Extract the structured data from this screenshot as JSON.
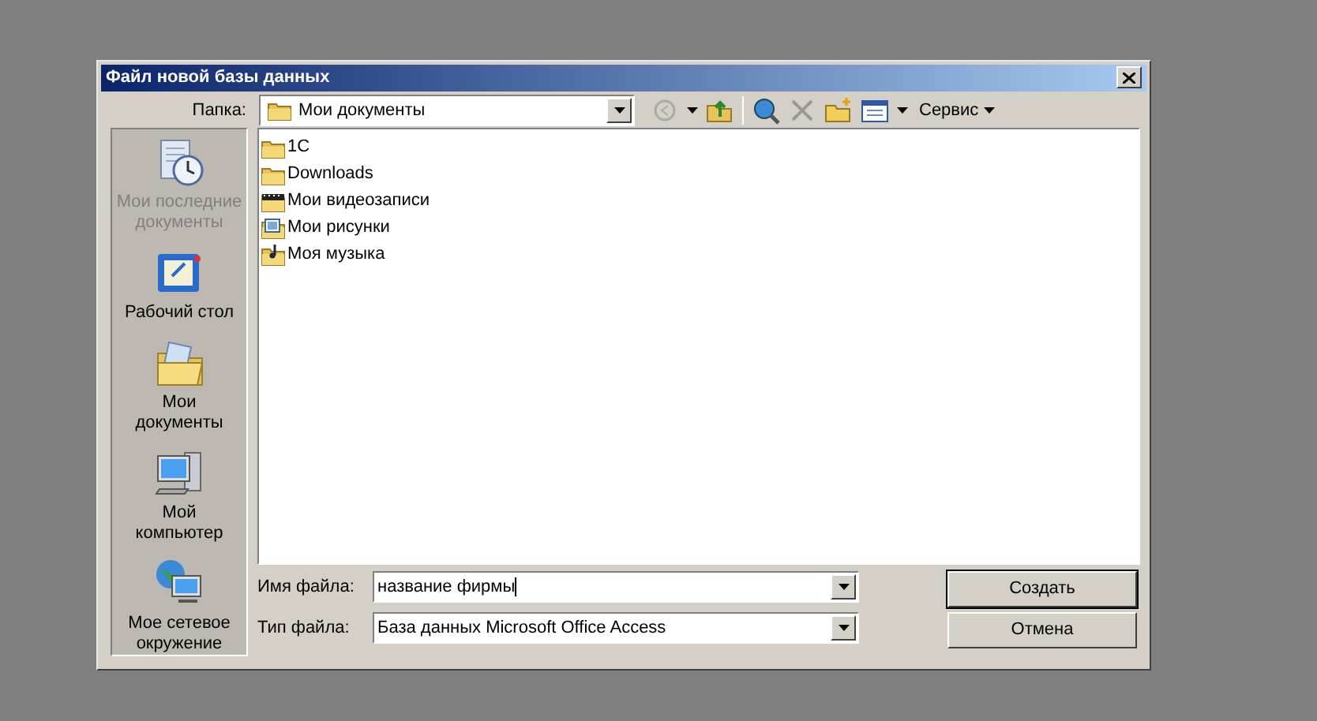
{
  "window": {
    "title": "Файл новой базы данных"
  },
  "folder": {
    "label": "Папка:",
    "value": "Мои документы"
  },
  "toolbar": {
    "tools_menu": "Сервис"
  },
  "places": [
    {
      "label": "Мои последние документы",
      "kind": "recent",
      "disabled": true
    },
    {
      "label": "Рабочий стол",
      "kind": "desktop",
      "disabled": false
    },
    {
      "label": "Мои документы",
      "kind": "documents",
      "disabled": false
    },
    {
      "label": "Мой компьютер",
      "kind": "computer",
      "disabled": false
    },
    {
      "label": "Мое сетевое окружение",
      "kind": "network",
      "disabled": false
    }
  ],
  "files": [
    {
      "name": "1C",
      "kind": "folder"
    },
    {
      "name": "Downloads",
      "kind": "folder"
    },
    {
      "name": "Мои видеозаписи",
      "kind": "video"
    },
    {
      "name": "Мои рисунки",
      "kind": "pictures"
    },
    {
      "name": "Моя музыка",
      "kind": "music"
    }
  ],
  "file_name": {
    "label": "Имя файла:",
    "value": "название фирмы"
  },
  "file_type": {
    "label": "Тип файла:",
    "value": "База данных Microsoft Office Access"
  },
  "buttons": [
    {
      "label": "Создать",
      "default": true
    },
    {
      "label": "Отмена",
      "default": false
    }
  ]
}
